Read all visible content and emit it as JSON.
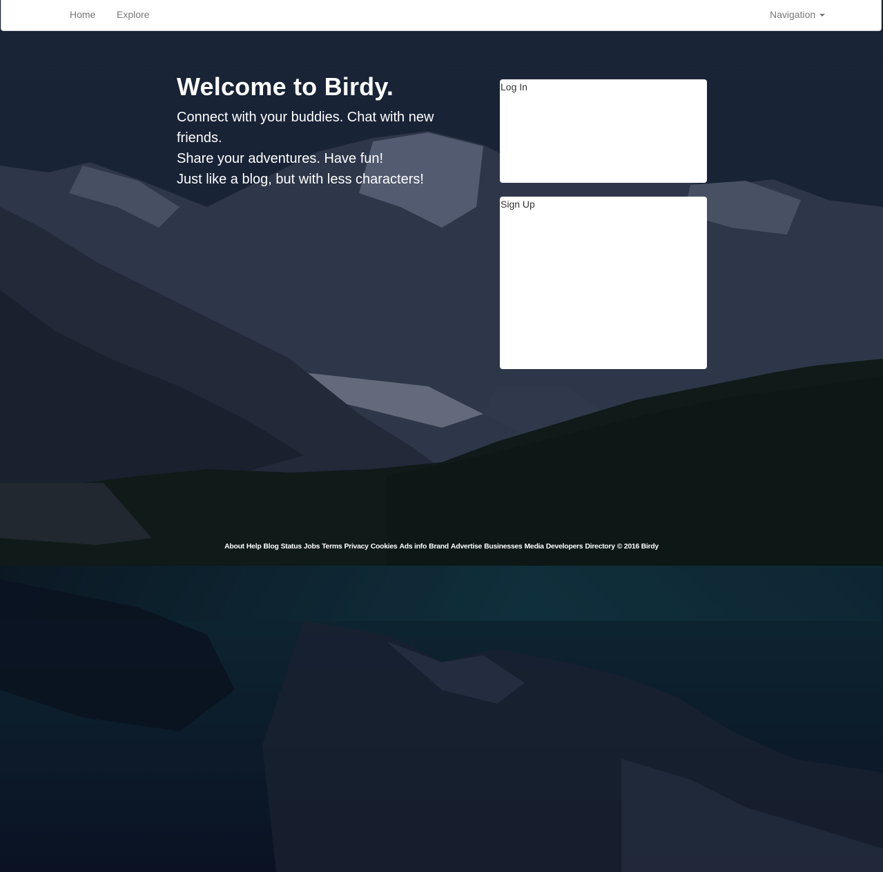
{
  "nav": {
    "home": "Home",
    "explore": "Explore",
    "dropdown": "Navigation"
  },
  "hero": {
    "title": "Welcome to Birdy.",
    "line1": "Connect with your buddies. Chat with new friends.",
    "line2": "Share your adventures. Have fun!",
    "line3": "Just like a blog, but with less characters!"
  },
  "panels": {
    "login_title": "Log In",
    "signup_title": "Sign Up"
  },
  "footer": {
    "links": [
      "About",
      "Help",
      "Blog",
      "Status",
      "Jobs",
      "Terms",
      "Privacy",
      "Cookies",
      "Ads info",
      "Brand",
      "Advertise",
      "Businesses",
      "Media",
      "Developers",
      "Directory"
    ],
    "copyright": "© 2016 Birdy"
  },
  "colors": {
    "navbar_bg": "#ffffff",
    "nav_text": "#777777",
    "hero_text": "#ffffff",
    "panel_bg": "#ffffff"
  },
  "icons": {
    "dropdown": "caret-down-icon"
  }
}
